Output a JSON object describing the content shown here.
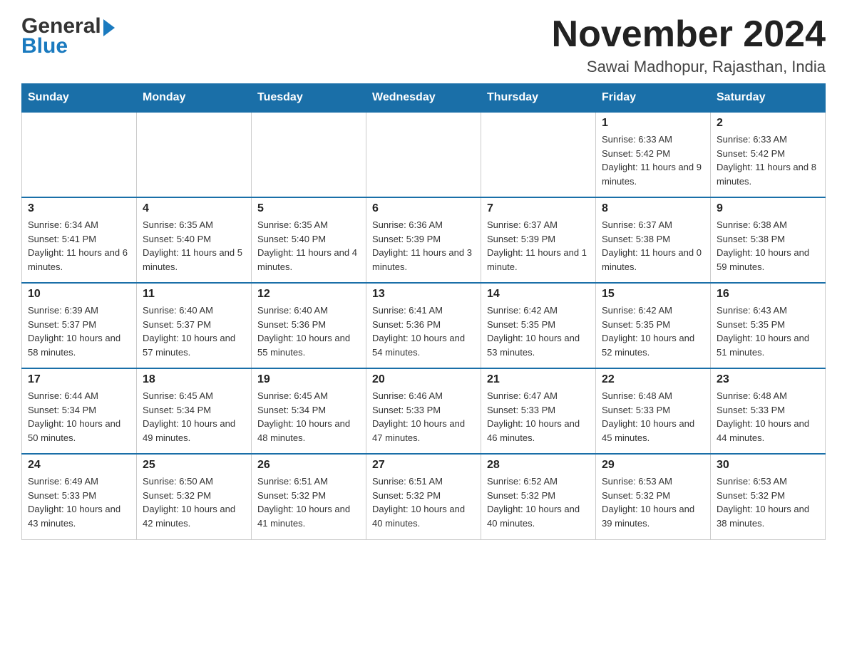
{
  "header": {
    "logo_general": "General",
    "logo_blue": "Blue",
    "month_title": "November 2024",
    "location": "Sawai Madhopur, Rajasthan, India"
  },
  "days_of_week": [
    "Sunday",
    "Monday",
    "Tuesday",
    "Wednesday",
    "Thursday",
    "Friday",
    "Saturday"
  ],
  "weeks": [
    {
      "days": [
        {
          "number": "",
          "info": ""
        },
        {
          "number": "",
          "info": ""
        },
        {
          "number": "",
          "info": ""
        },
        {
          "number": "",
          "info": ""
        },
        {
          "number": "",
          "info": ""
        },
        {
          "number": "1",
          "info": "Sunrise: 6:33 AM\nSunset: 5:42 PM\nDaylight: 11 hours and 9 minutes."
        },
        {
          "number": "2",
          "info": "Sunrise: 6:33 AM\nSunset: 5:42 PM\nDaylight: 11 hours and 8 minutes."
        }
      ]
    },
    {
      "days": [
        {
          "number": "3",
          "info": "Sunrise: 6:34 AM\nSunset: 5:41 PM\nDaylight: 11 hours and 6 minutes."
        },
        {
          "number": "4",
          "info": "Sunrise: 6:35 AM\nSunset: 5:40 PM\nDaylight: 11 hours and 5 minutes."
        },
        {
          "number": "5",
          "info": "Sunrise: 6:35 AM\nSunset: 5:40 PM\nDaylight: 11 hours and 4 minutes."
        },
        {
          "number": "6",
          "info": "Sunrise: 6:36 AM\nSunset: 5:39 PM\nDaylight: 11 hours and 3 minutes."
        },
        {
          "number": "7",
          "info": "Sunrise: 6:37 AM\nSunset: 5:39 PM\nDaylight: 11 hours and 1 minute."
        },
        {
          "number": "8",
          "info": "Sunrise: 6:37 AM\nSunset: 5:38 PM\nDaylight: 11 hours and 0 minutes."
        },
        {
          "number": "9",
          "info": "Sunrise: 6:38 AM\nSunset: 5:38 PM\nDaylight: 10 hours and 59 minutes."
        }
      ]
    },
    {
      "days": [
        {
          "number": "10",
          "info": "Sunrise: 6:39 AM\nSunset: 5:37 PM\nDaylight: 10 hours and 58 minutes."
        },
        {
          "number": "11",
          "info": "Sunrise: 6:40 AM\nSunset: 5:37 PM\nDaylight: 10 hours and 57 minutes."
        },
        {
          "number": "12",
          "info": "Sunrise: 6:40 AM\nSunset: 5:36 PM\nDaylight: 10 hours and 55 minutes."
        },
        {
          "number": "13",
          "info": "Sunrise: 6:41 AM\nSunset: 5:36 PM\nDaylight: 10 hours and 54 minutes."
        },
        {
          "number": "14",
          "info": "Sunrise: 6:42 AM\nSunset: 5:35 PM\nDaylight: 10 hours and 53 minutes."
        },
        {
          "number": "15",
          "info": "Sunrise: 6:42 AM\nSunset: 5:35 PM\nDaylight: 10 hours and 52 minutes."
        },
        {
          "number": "16",
          "info": "Sunrise: 6:43 AM\nSunset: 5:35 PM\nDaylight: 10 hours and 51 minutes."
        }
      ]
    },
    {
      "days": [
        {
          "number": "17",
          "info": "Sunrise: 6:44 AM\nSunset: 5:34 PM\nDaylight: 10 hours and 50 minutes."
        },
        {
          "number": "18",
          "info": "Sunrise: 6:45 AM\nSunset: 5:34 PM\nDaylight: 10 hours and 49 minutes."
        },
        {
          "number": "19",
          "info": "Sunrise: 6:45 AM\nSunset: 5:34 PM\nDaylight: 10 hours and 48 minutes."
        },
        {
          "number": "20",
          "info": "Sunrise: 6:46 AM\nSunset: 5:33 PM\nDaylight: 10 hours and 47 minutes."
        },
        {
          "number": "21",
          "info": "Sunrise: 6:47 AM\nSunset: 5:33 PM\nDaylight: 10 hours and 46 minutes."
        },
        {
          "number": "22",
          "info": "Sunrise: 6:48 AM\nSunset: 5:33 PM\nDaylight: 10 hours and 45 minutes."
        },
        {
          "number": "23",
          "info": "Sunrise: 6:48 AM\nSunset: 5:33 PM\nDaylight: 10 hours and 44 minutes."
        }
      ]
    },
    {
      "days": [
        {
          "number": "24",
          "info": "Sunrise: 6:49 AM\nSunset: 5:33 PM\nDaylight: 10 hours and 43 minutes."
        },
        {
          "number": "25",
          "info": "Sunrise: 6:50 AM\nSunset: 5:32 PM\nDaylight: 10 hours and 42 minutes."
        },
        {
          "number": "26",
          "info": "Sunrise: 6:51 AM\nSunset: 5:32 PM\nDaylight: 10 hours and 41 minutes."
        },
        {
          "number": "27",
          "info": "Sunrise: 6:51 AM\nSunset: 5:32 PM\nDaylight: 10 hours and 40 minutes."
        },
        {
          "number": "28",
          "info": "Sunrise: 6:52 AM\nSunset: 5:32 PM\nDaylight: 10 hours and 40 minutes."
        },
        {
          "number": "29",
          "info": "Sunrise: 6:53 AM\nSunset: 5:32 PM\nDaylight: 10 hours and 39 minutes."
        },
        {
          "number": "30",
          "info": "Sunrise: 6:53 AM\nSunset: 5:32 PM\nDaylight: 10 hours and 38 minutes."
        }
      ]
    }
  ]
}
